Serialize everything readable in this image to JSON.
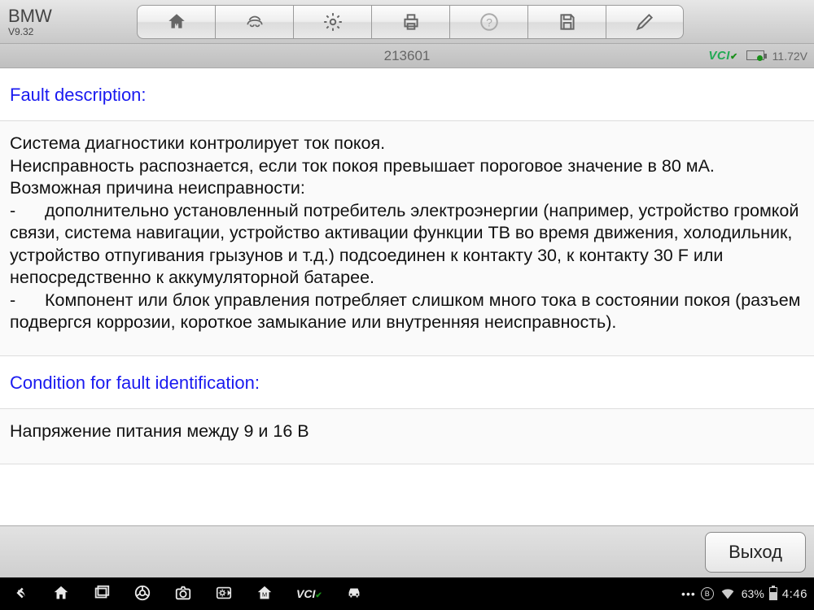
{
  "app": {
    "name": "BMW",
    "version": "V9.32"
  },
  "subbar": {
    "code": "213601",
    "vci": "VCI",
    "voltage": "11.72V"
  },
  "sections": {
    "fault_description": {
      "title": "Fault description:",
      "body": "Система диагностики контролирует ток покоя.\nНеисправность распознается, если ток покоя превышает пороговое значение в 80 мА.\nВозможная причина неисправности:\n-      дополнительно установленный потребитель электроэнергии (например, устройство громкой связи, система навигации, устройство активации функции ТВ во время движения, холодильник, устройство отпугивания грызунов и т.д.) подсоединен к контакту 30, к контакту 30 F или непосредственно к аккумуляторной батарее.\n-      Компонент или блок управления потребляет слишком много тока в состоянии покоя (разъем подвергся коррозии, короткое замыкание или внутренняя неисправность)."
    },
    "condition": {
      "title": "Condition for fault identification:",
      "body": "Напряжение питания между 9 и 16 В"
    }
  },
  "footer": {
    "exit": "Выход"
  },
  "sysbar": {
    "battery_pct": "63%",
    "clock": "4:46",
    "home_badge": "M",
    "vci": "VCI"
  }
}
